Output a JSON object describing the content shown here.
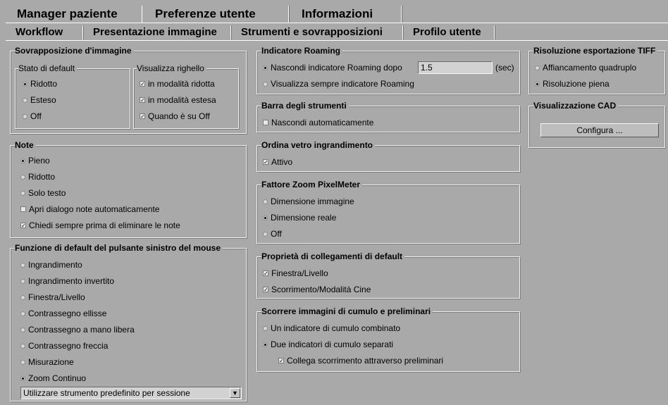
{
  "top_tabs": [
    "Manager paziente",
    "Preferenze utente",
    "Informazioni"
  ],
  "sub_tabs": [
    "Workflow",
    "Presentazione immagine",
    "Strumenti e sovrapposizioni",
    "Profilo utente"
  ],
  "overlay": {
    "title": "Sovrapposizione d'immagine",
    "default_state": {
      "title": "Stato di default",
      "options": [
        "Ridotto",
        "Esteso",
        "Off"
      ],
      "selected": "Ridotto"
    },
    "ruler": {
      "title": "Visualizza righello",
      "options": [
        "in modalità ridotta",
        "in modalità estesa",
        "Quando è su Off"
      ]
    }
  },
  "notes": {
    "title": "Note",
    "options": [
      "Pieno",
      "Ridotto",
      "Solo testo"
    ],
    "selected": "Pieno",
    "checks": [
      "Apri dialogo note automaticamente",
      "Chiedi sempre prima di eliminare le note"
    ]
  },
  "mouse": {
    "title": "Funzione di default del pulsante sinistro del mouse",
    "options": [
      "Ingrandimento",
      "Ingrandimento invertito",
      "Finestra/Livello",
      "Contrassegno ellisse",
      "Contrassegno a mano libera",
      "Contrassegno freccia",
      "Misurazione",
      "Zoom Continuo"
    ],
    "selected": "Zoom Continuo",
    "select_value": "Utilizzare strumento predefinito per sessione"
  },
  "roaming": {
    "title": "Indicatore Roaming",
    "hide_label": "Nascondi indicatore Roaming dopo",
    "hide_value": "1.5",
    "unit": "(sec)",
    "always_label": "Visualizza sempre indicatore Roaming"
  },
  "toolbar": {
    "title": "Barra degli strumenti",
    "check": "Nascondi automaticamente"
  },
  "magnifier": {
    "title": "Ordina vetro ingrandimento",
    "check": "Attivo"
  },
  "pixelmeter": {
    "title": "Fattore Zoom PixelMeter",
    "options": [
      "Dimensione immagine",
      "Dimensione reale",
      "Off"
    ],
    "selected": "Dimensione reale"
  },
  "links": {
    "title": "Proprietà di collegamenti di default",
    "checks": [
      "Finestra/Livello",
      "Scorrimento/Modalità Cine"
    ]
  },
  "stack": {
    "title": "Scorrere immagini di cumulo e preliminari",
    "options": [
      "Un indicatore di cumulo combinato",
      "Due indicatori di cumulo separati"
    ],
    "selected": "Due indicatori di cumulo separati",
    "check": "Collega scorrimento attraverso preliminari"
  },
  "tiff": {
    "title": "Risoluzione esportazione TIFF",
    "options": [
      "Affiancamento quadruplo",
      "Risoluzione piena"
    ],
    "selected": "Risoluzione piena"
  },
  "cad": {
    "title": "Visualizzazione CAD",
    "button": "Configura ..."
  }
}
